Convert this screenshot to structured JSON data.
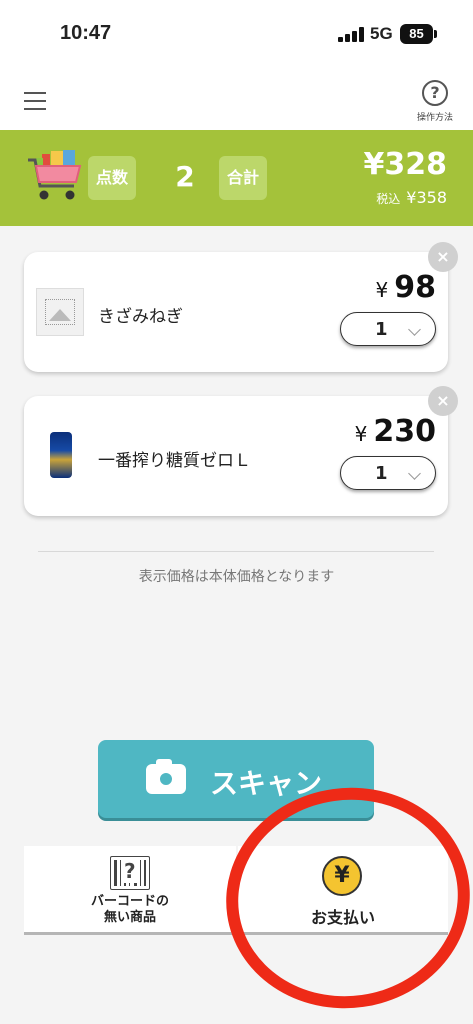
{
  "status_bar": {
    "time": "10:47",
    "network": "5G",
    "battery": "85"
  },
  "nav": {
    "help_label": "操作方法",
    "help_glyph": "?"
  },
  "summary": {
    "count_label": "点数",
    "count": "2",
    "total_label": "合計",
    "total": "¥328",
    "tax_label": "税込",
    "tax_total": "¥358",
    "band_color": "#a4c23a"
  },
  "items": [
    {
      "name": "きざみねぎ",
      "yen": "¥",
      "price": "98",
      "qty": "1",
      "remove": "×"
    },
    {
      "name": "一番搾り糖質ゼロＬ",
      "yen": "¥",
      "price": "230",
      "qty": "1",
      "remove": "×"
    }
  ],
  "note": "表示価格は本体価格となります",
  "scan_button": {
    "label": "スキャン",
    "color": "#4fb7c3"
  },
  "barcode_button": {
    "line1": "バーコードの",
    "line2": "無い商品",
    "glyph": "?"
  },
  "pay_button": {
    "label": "お支払い",
    "glyph": "¥"
  },
  "annotation_color": "#ee2a17"
}
